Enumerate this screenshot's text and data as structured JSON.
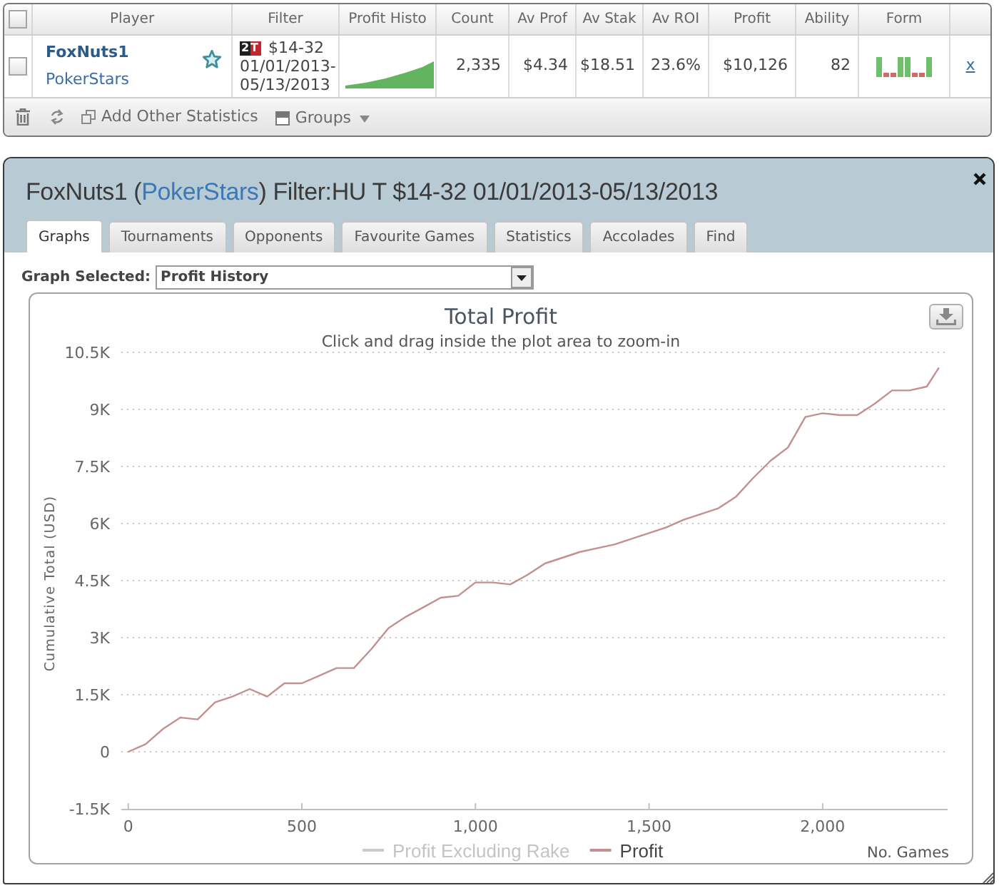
{
  "stats_table": {
    "select_all": {
      "checked": false
    },
    "columns": [
      "Player",
      "Filter",
      "Profit Histo",
      "Count",
      "Av Prof",
      "Av Stak",
      "Av ROI",
      "Profit",
      "Ability",
      "Form"
    ],
    "rows": [
      {
        "checked": false,
        "player": "FoxNuts1",
        "site": "PokerStars",
        "filter": {
          "badge": "2T",
          "stakes": "$14-32",
          "date_lines": [
            "01/01/2013-",
            "05/13/2013"
          ]
        },
        "count": "2,335",
        "av_prof": "$4.34",
        "av_stak": "$18.51",
        "av_roi": "23.6%",
        "profit": "$10,126",
        "ability": "82",
        "form": [
          {
            "kind": "win"
          },
          {
            "kind": "loss"
          },
          {
            "kind": "loss"
          },
          {
            "kind": "win"
          },
          {
            "kind": "win"
          },
          {
            "kind": "loss"
          },
          {
            "kind": "loss"
          },
          {
            "kind": "win"
          }
        ],
        "remove": "x"
      }
    ]
  },
  "toolbar": {
    "items": [
      {
        "kind": "delete"
      },
      {
        "kind": "refresh"
      },
      {
        "kind": "add",
        "label": "Add Other Statistics"
      },
      {
        "kind": "groups",
        "label": "Groups"
      }
    ]
  },
  "player_panel": {
    "title_before": "FoxNuts1 (",
    "title_link": "PokerStars",
    "title_after": ") Filter:HU T $14-32 01/01/2013-05/13/2013",
    "tabs": [
      {
        "label": "Graphs",
        "selected": true
      },
      {
        "label": "Tournaments",
        "selected": false
      },
      {
        "label": "Opponents",
        "selected": false
      },
      {
        "label": "Favourite Games",
        "selected": false
      },
      {
        "label": "Statistics",
        "selected": false
      },
      {
        "label": "Accolades",
        "selected": false
      },
      {
        "label": "Find",
        "selected": false
      }
    ],
    "graph_select": {
      "label": "Graph Selected:",
      "value": "Profit History"
    },
    "graph": {
      "subtitle": "Click and drag inside the plot area to zoom-in",
      "legend": [
        {
          "label": "Profit Excluding Rake",
          "visible": false
        }
      ],
      "chart_data": {
        "type": "line",
        "title": "Total Profit",
        "xlabel": "No. Games",
        "ylabel": "Cumulative Total (USD)",
        "xlim": [
          -20,
          2360
        ],
        "ylim": [
          -1500,
          10500
        ],
        "grid": true,
        "xticks": [
          {
            "value": 0,
            "label": "0"
          },
          {
            "value": 500,
            "label": "500"
          },
          {
            "value": 1000,
            "label": "1,000"
          },
          {
            "value": 1500,
            "label": "1,500"
          },
          {
            "value": 2000,
            "label": "2,000"
          }
        ],
        "yticks": [
          {
            "value": -1500,
            "label": "-1.5K"
          },
          {
            "value": 0,
            "label": "0"
          },
          {
            "value": 1500,
            "label": "1.5K"
          },
          {
            "value": 3000,
            "label": "3K"
          },
          {
            "value": 4500,
            "label": "4.5K"
          },
          {
            "value": 6000,
            "label": "6K"
          },
          {
            "value": 7500,
            "label": "7.5K"
          },
          {
            "value": 9000,
            "label": "9K"
          },
          {
            "value": 10500,
            "label": "10.5K"
          }
        ],
        "x": [
          0,
          50,
          100,
          150,
          200,
          250,
          300,
          350,
          400,
          450,
          500,
          550,
          600,
          650,
          700,
          750,
          800,
          850,
          900,
          950,
          1000,
          1050,
          1100,
          1150,
          1200,
          1250,
          1300,
          1350,
          1400,
          1450,
          1500,
          1550,
          1600,
          1650,
          1700,
          1750,
          1800,
          1850,
          1900,
          1950,
          2000,
          2050,
          2100,
          2150,
          2200,
          2250,
          2300,
          2335
        ],
        "series": [
          {
            "name": "Profit",
            "color": "#c48f8f",
            "values": [
              0,
              200,
              600,
              900,
              850,
              1300,
              1450,
              1650,
              1450,
              1800,
              1800,
              2000,
              2200,
              2200,
              2700,
              3250,
              3550,
              3800,
              4050,
              4100,
              4450,
              4450,
              4400,
              4650,
              4950,
              5100,
              5250,
              5350,
              5450,
              5600,
              5750,
              5900,
              6100,
              6250,
              6400,
              6700,
              7200,
              7650,
              8000,
              8800,
              8900,
              8850,
              8850,
              9150,
              9500,
              9500,
              9600,
              10100
            ]
          }
        ]
      }
    }
  }
}
